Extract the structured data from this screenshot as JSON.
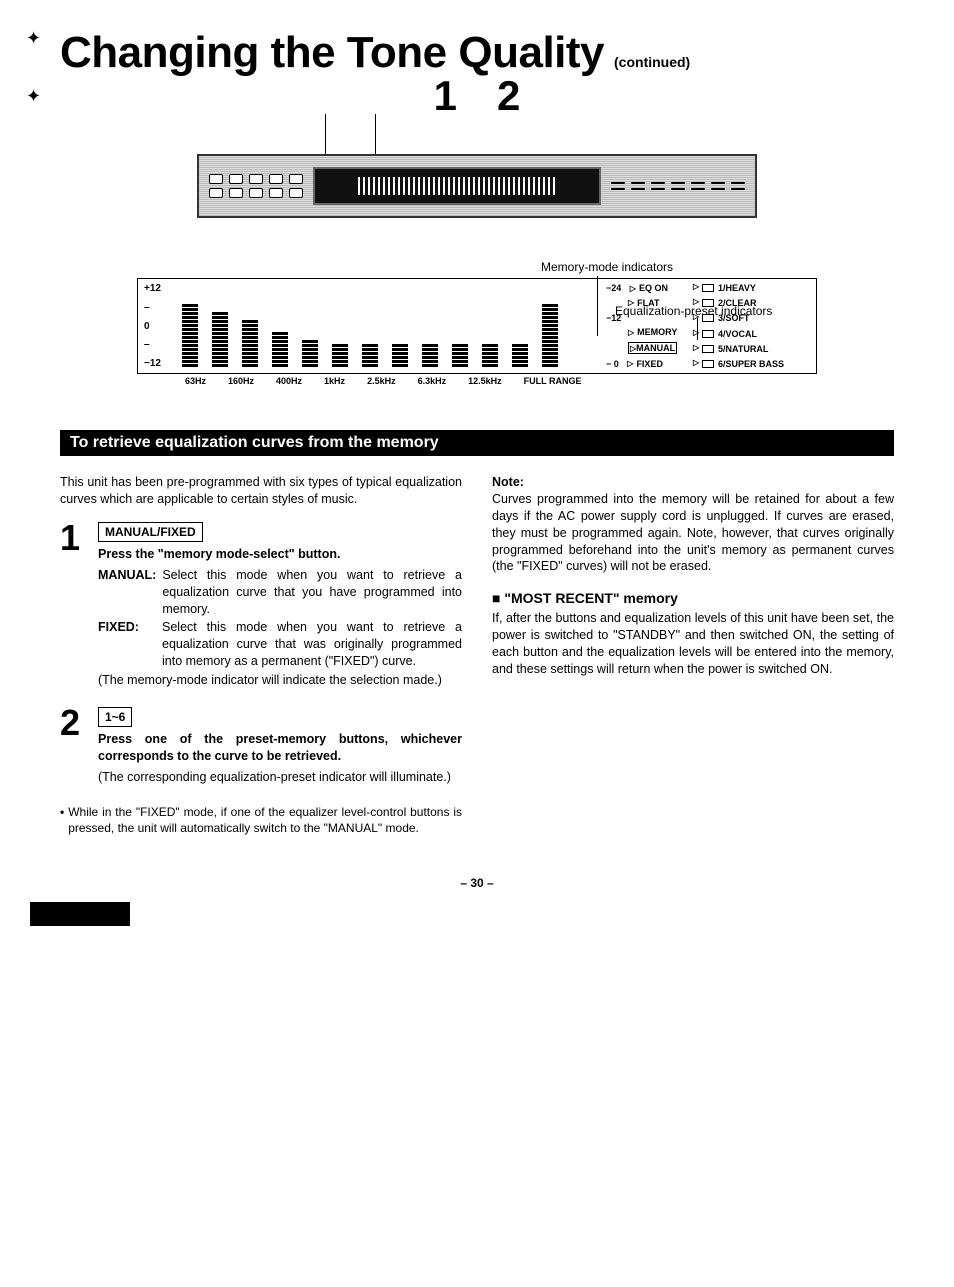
{
  "header": {
    "title": "Changing the Tone Quality",
    "continued": "(continued)"
  },
  "step_leaders": {
    "one": "1",
    "two": "2"
  },
  "callouts": {
    "memory_mode": "Memory-mode indicators",
    "eq_preset": "Equalization-preset indicators"
  },
  "detail": {
    "y_top": "+12",
    "y_mid": "0",
    "y_bot": "−12",
    "right_scale_top": "−24",
    "right_scale_mid": "−12",
    "right_scale_bot": "− 0",
    "modes": {
      "eq_on": "EQ ON",
      "flat": "FLAT",
      "memory": "MEMORY",
      "manual": "MANUAL",
      "fixed": "FIXED"
    },
    "presets": {
      "p1": "1/HEAVY",
      "p2": "2/CLEAR",
      "p3": "3/SOFT",
      "p4": "4/VOCAL",
      "p5": "5/NATURAL",
      "p6": "6/SUPER BASS"
    },
    "x_labels": {
      "x1": "63Hz",
      "x2": "160Hz",
      "x3": "400Hz",
      "x4": "1kHz",
      "x5": "2.5kHz",
      "x6": "6.3kHz",
      "x7": "12.5kHz",
      "x8": "FULL RANGE"
    }
  },
  "section_title": "To retrieve equalization curves from the memory",
  "left": {
    "intro": "This unit has been pre-programmed with six types of typical equalization curves which are applicable to certain styles of music.",
    "step1": {
      "num": "1",
      "box": "MANUAL/FIXED",
      "title": "Press the \"memory mode-select\" button.",
      "manual_term": "MANUAL:",
      "manual_val": "Select this mode when you want to retrieve a equalization curve that you have programmed into memory.",
      "fixed_term": "FIXED:",
      "fixed_val": "Select this mode when you want to retrieve a equalization curve that was originally programmed into memory as a permanent (\"FIXED\") curve.",
      "note": "(The memory-mode indicator will indicate the selection made.)"
    },
    "step2": {
      "num": "2",
      "box": "1~6",
      "title": "Press one of the preset-memory buttons, whichever corresponds to the curve to be retrieved.",
      "note": "(The corresponding equalization-preset indicator will illuminate.)"
    },
    "bullet": "While in the \"FIXED\" mode, if one of the equalizer level-control buttons is pressed, the unit will automatically switch to the \"MANUAL\" mode."
  },
  "right": {
    "note_label": "Note:",
    "note_body": "Curves programmed into the memory will be retained for about a few days if the AC power supply cord is unplugged. If curves are erased, they must be programmed again. Note, however, that curves originally programmed beforehand into the unit's memory as permanent curves (the \"FIXED\" curves) will not be erased.",
    "sub_heading": "\"MOST RECENT\" memory",
    "sub_body": "If, after the buttons and equalization levels of this unit have been set, the power is switched to \"STANDBY\" and then switched ON, the setting of each button and the equalization levels will be entered into the memory, and these settings will return when the power is switched ON."
  },
  "page_number": "– 30 –"
}
